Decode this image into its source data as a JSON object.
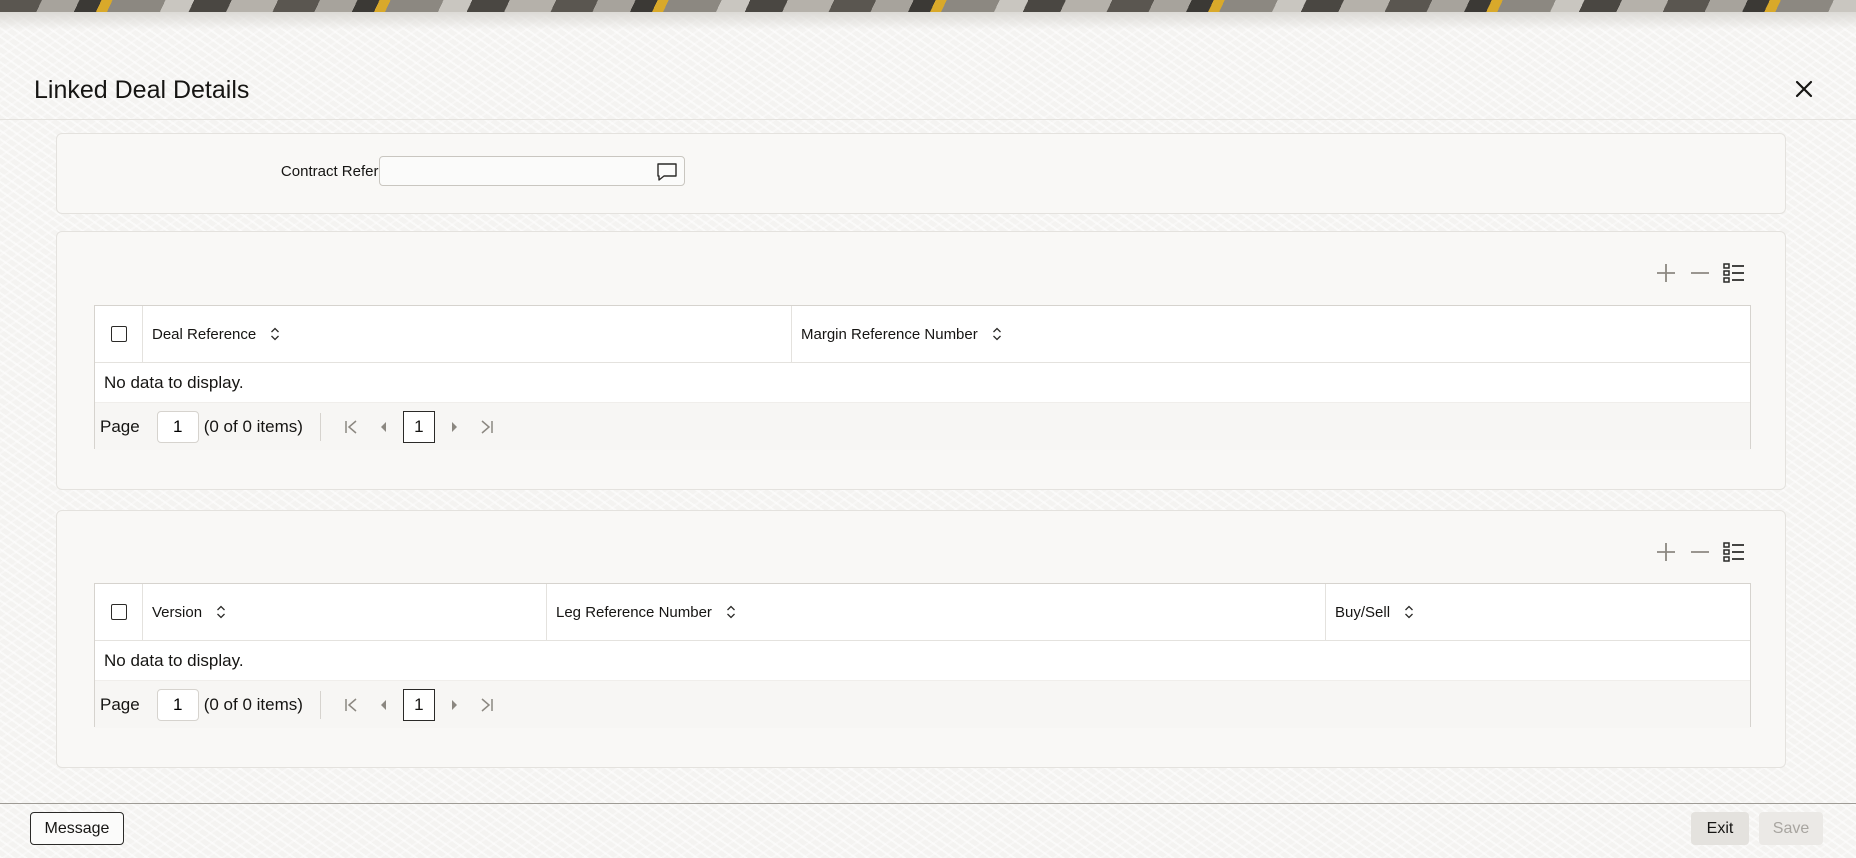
{
  "dialog": {
    "title": "Linked Deal Details"
  },
  "contract": {
    "label": "Contract Reference",
    "value": ""
  },
  "grid1": {
    "columns": [
      "Deal Reference",
      "Margin Reference Number"
    ],
    "empty_message": "No data to display.",
    "pager": {
      "page_label": "Page",
      "page_value": "1",
      "count": "(0 of 0 items)",
      "current_page": "1"
    }
  },
  "grid2": {
    "columns": [
      "Version",
      "Leg Reference Number",
      "Buy/Sell"
    ],
    "empty_message": "No data to display.",
    "pager": {
      "page_label": "Page",
      "page_value": "1",
      "count": "(0 of 0 items)",
      "current_page": "1"
    }
  },
  "footer": {
    "message_label": "Message",
    "exit_label": "Exit",
    "save_label": "Save"
  },
  "icons": {
    "close": "close-icon",
    "lov": "comment-icon",
    "add": "plus-icon",
    "remove": "minus-icon",
    "details": "list-details-icon",
    "sort": "sort-icon",
    "first": "first-page-icon",
    "prev": "previous-page-icon",
    "next": "next-page-icon",
    "last": "last-page-icon"
  },
  "colors": {
    "text": "#161513",
    "border": "#d6d3ce",
    "panel_bg": "#f9f8f6",
    "disabled_text": "#a8a5a0"
  }
}
